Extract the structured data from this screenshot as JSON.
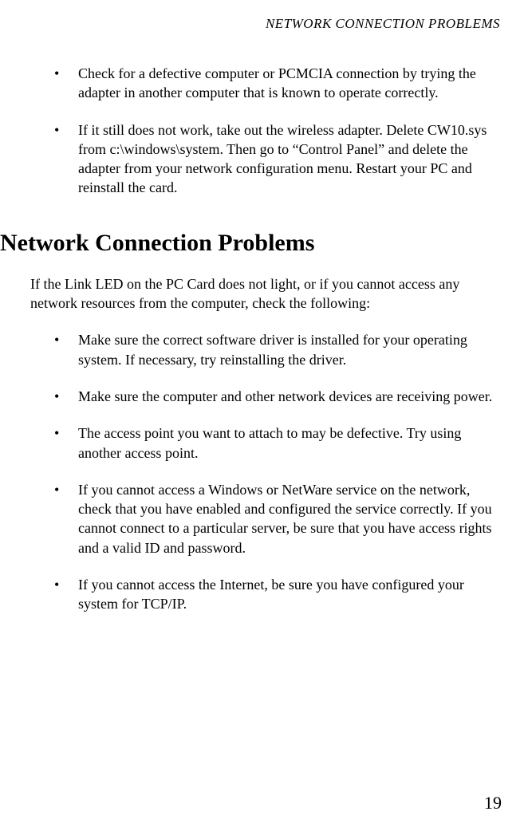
{
  "running_header": "NETWORK CONNECTION PROBLEMS",
  "top_bullets": [
    "Check for a defective computer or PCMCIA connection by trying the adapter in another computer that is known to operate correctly.",
    "If it still does not work, take out the wireless adapter. Delete CW10.sys from c:\\windows\\system. Then go to “Control Panel” and delete the adapter from your network configuration menu. Restart your PC and reinstall the card."
  ],
  "section_heading": "Network Connection Problems",
  "intro_paragraph": "If the Link LED on the PC Card does not light, or if you cannot access any network resources from the computer, check the following:",
  "section_bullets": [
    "Make sure the correct software driver is installed for your operating system. If necessary, try reinstalling the driver.",
    "Make sure the computer and other network devices are receiving power.",
    "The access point you want to attach to may be defective. Try using another access point.",
    "If you cannot access a Windows or NetWare service on the network, check that you have enabled and configured the service correctly. If you cannot connect to a particular server, be sure that you have access rights and a valid ID and password.",
    "If you cannot access the Internet, be sure you have configured your system for TCP/IP."
  ],
  "page_number": "19"
}
